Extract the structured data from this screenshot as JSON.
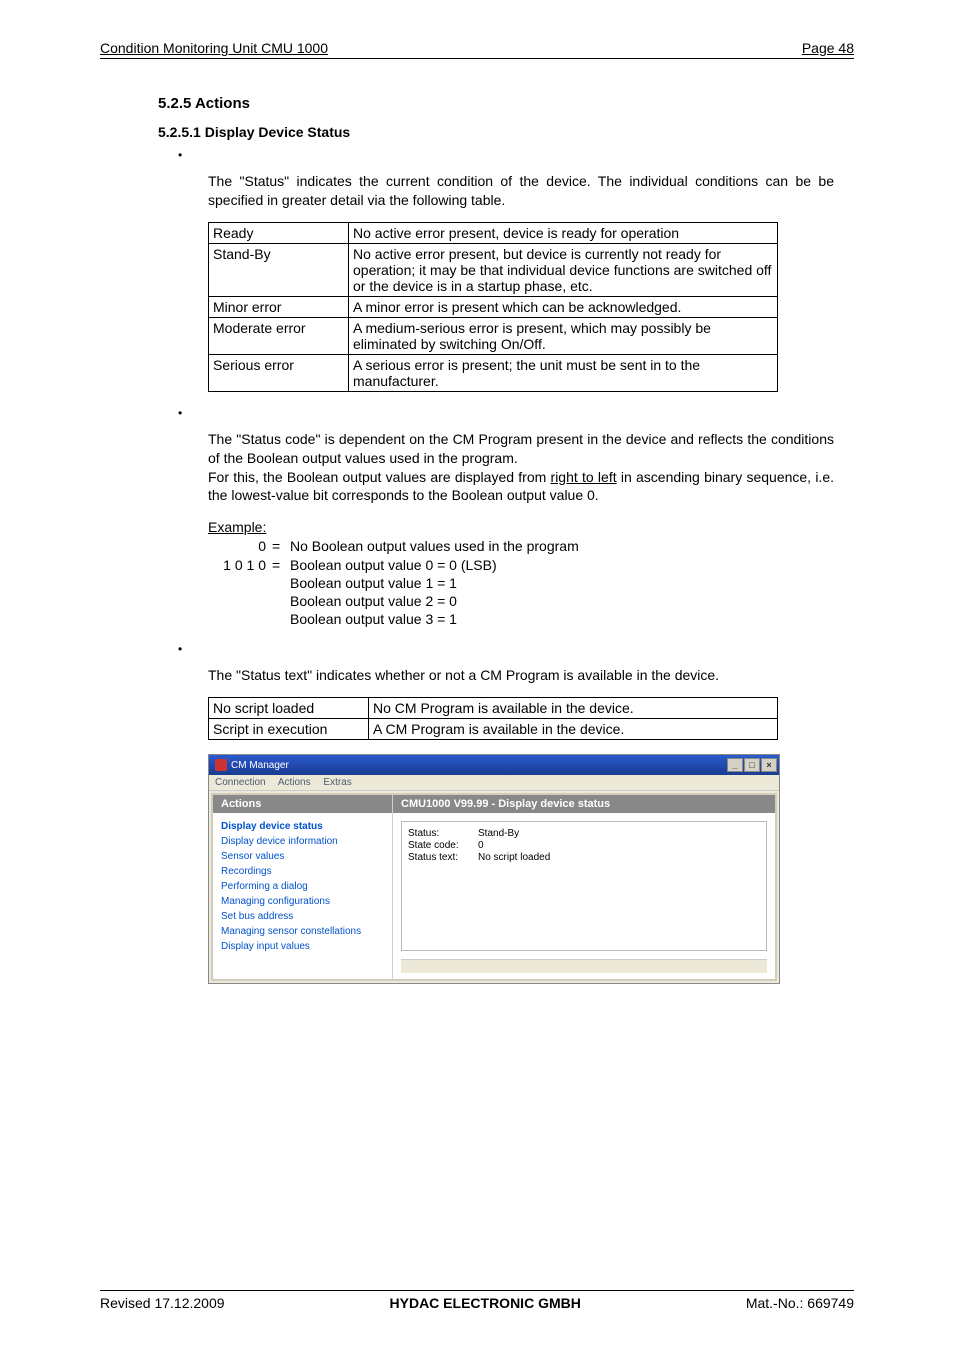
{
  "header": {
    "left": "Condition Monitoring Unit CMU 1000",
    "right": "Page 48"
  },
  "section": {
    "num_title": "5.2.5  Actions",
    "sub_num_title": "5.2.5.1  Display Device Status"
  },
  "para1": "The \"Status\" indicates the current condition of the device. The individual conditions can be be specified in greater detail via the following table.",
  "table1": {
    "rows": [
      {
        "c1": "Ready",
        "c2": "No active error present, device is ready for operation"
      },
      {
        "c1": "Stand-By",
        "c2": "No active error present, but device is currently not ready for operation; it may be that individual device functions are switched off or the device is in a startup phase, etc."
      },
      {
        "c1": "Minor error",
        "c2": "A minor error is present which can be acknowledged."
      },
      {
        "c1": "Moderate error",
        "c2": "A medium-serious error is present, which may possibly be eliminated by switching On/Off."
      },
      {
        "c1": "Serious error",
        "c2": "A serious error is present; the unit must be sent in to the manufacturer."
      }
    ]
  },
  "para2_pre": "The \"Status code\" is dependent on the CM Program present in the device and reflects the conditions of the Boolean output values used in the program.",
  "para2_line2a": "For this, the Boolean output values are displayed from ",
  "para2_line2_underline": "right to left",
  "para2_line2b": " in ascending binary sequence, i.e. the lowest-value bit corresponds to the Boolean output value 0.",
  "example_label": "Example:",
  "example": {
    "r1": {
      "left": "0",
      "eq": "=",
      "text": "No Boolean output values used in the program"
    },
    "r2": {
      "left": "1 0 1 0",
      "eq": "=",
      "text": "Boolean output value 0  =  0  (LSB)"
    },
    "r3": {
      "left": "",
      "eq": "",
      "text": "Boolean output value 1  =  1"
    },
    "r4": {
      "left": "",
      "eq": "",
      "text": "Boolean output value 2  =  0"
    },
    "r5": {
      "left": "",
      "eq": "",
      "text": "Boolean output value 3  =  1"
    }
  },
  "para3": "The \"Status text\" indicates whether or not a CM Program is available in the device.",
  "table2": {
    "rows": [
      {
        "c1": "No script loaded",
        "c2": "No CM Program is available in the device."
      },
      {
        "c1": "Script in execution",
        "c2": "A CM Program is available in the device."
      }
    ]
  },
  "window": {
    "title": "CM Manager",
    "menu": {
      "m1": "Connection",
      "m2": "Actions",
      "m3": "Extras"
    },
    "sidebar_header": "Actions",
    "sidebar_items": [
      "Display device status",
      "Display device information",
      "Sensor values",
      "Recordings",
      "Performing a dialog",
      "Managing configurations",
      "Set bus address",
      "Managing sensor constellations",
      "Display input values"
    ],
    "main_header": "CMU1000 V99.99 - Display device status",
    "kv": [
      {
        "k": "Status:",
        "v": "Stand-By"
      },
      {
        "k": "State code:",
        "v": "0"
      },
      {
        "k": "Status text:",
        "v": "No script loaded"
      }
    ],
    "ctrl_min": "_",
    "ctrl_max": "□",
    "ctrl_close": "×"
  },
  "footer": {
    "left": "Revised 17.12.2009",
    "center": "HYDAC ELECTRONIC GMBH",
    "right": "Mat.-No.: 669749"
  }
}
